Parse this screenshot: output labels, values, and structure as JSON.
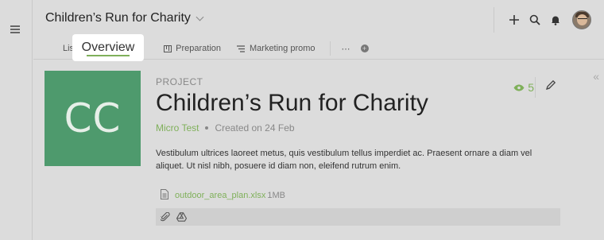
{
  "header": {
    "project_title": "Children’s Run for Charity"
  },
  "tabs": [
    {
      "label": "List"
    },
    {
      "label": "Overview",
      "active": true
    },
    {
      "label": "Preparation",
      "icon": "board-icon"
    },
    {
      "label": "Marketing promo",
      "icon": "list-icon"
    }
  ],
  "tabs_more": "⋯",
  "project": {
    "kind": "PROJECT",
    "title": "Children’s Run for Charity",
    "initials": "CC",
    "team": "Micro Test",
    "created": "Created on 24 Feb",
    "description": "Vestibulum ultrices laoreet metus, quis vestibulum tellus imperdiet ac. Praesent ornare a diam vel aliquet. Ut nisl nibh, posuere id diam non, eleifend rutrum enim.",
    "watchers": "5"
  },
  "attachment": {
    "filename": "outdoor_area_plan.xlsx",
    "size": "1MB"
  },
  "colors": {
    "accent": "#7fb05a",
    "logo_bg": "#4e9a6d",
    "background": "#dcdcdc"
  }
}
